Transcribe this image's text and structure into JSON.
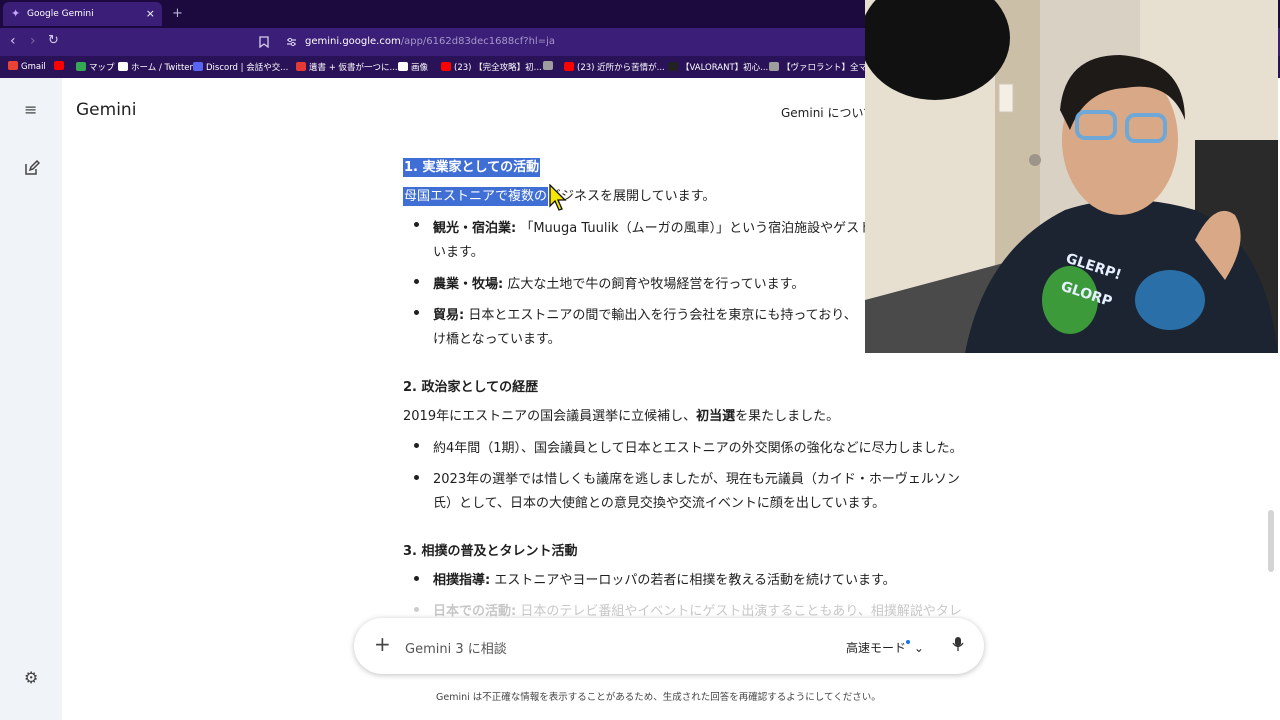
{
  "browser": {
    "tab_title": "Google Gemini",
    "tab_close": "×",
    "new_tab": "+",
    "url_host": "gemini.google.com",
    "url_path": "/app/6162d83dec1688cf?hl=ja",
    "bookmarks": [
      {
        "label": "Gmail",
        "color": "#ea4335"
      },
      {
        "label": "",
        "color": "#ff0000"
      },
      {
        "label": "マップ",
        "color": "#34a853"
      },
      {
        "label": "ホーム / Twitter",
        "color": "#ffffff"
      },
      {
        "label": "Discord | 会話や交...",
        "color": "#5865f2"
      },
      {
        "label": "遺書 + 仮書が一つに...",
        "color": "#e53935"
      },
      {
        "label": "画像",
        "color": "#ffffff"
      },
      {
        "label": "(23) 【完全攻略】初...",
        "color": "#ff0000"
      },
      {
        "label": "",
        "color": "#9e9e9e"
      },
      {
        "label": "(23) 近所から苦情が...",
        "color": "#ff0000"
      },
      {
        "label": "【VALORANT】初心...",
        "color": "#222222"
      },
      {
        "label": "【ヴァロラント】全マップ...",
        "color": "#9e9e9e"
      }
    ]
  },
  "app": {
    "brand": "Gemini",
    "about": "Gemini について"
  },
  "response": {
    "s1_heading": "1. 実業家としての活動",
    "s1_intro_sel": "母国エストニアで複数の",
    "s1_intro_rest": "ビジネスを展開しています。",
    "s1_b1_bold": "観光・宿泊業:",
    "s1_b1_text": " 「Muuga Tuulik（ムーガの風車）」という宿泊施設やゲスト",
    "s1_b1_line2": "います。",
    "s1_b2_bold": "農業・牧場:",
    "s1_b2_text": " 広大な土地で牛の飼育や牧場経営を行っています。",
    "s1_b3_bold": "貿易:",
    "s1_b3_text": " 日本とエストニアの間で輸出入を行う会社を東京にも持っており、",
    "s1_b3_line2": "け橋となっています。",
    "s2_heading": "2. 政治家としての経歴",
    "s2_intro_a": "2019年にエストニアの国会議員選挙に立候補し、",
    "s2_intro_bold": "初当選",
    "s2_intro_b": "を果たしました。",
    "s2_b1": "約4年間（1期）、国会議員として日本とエストニアの外交関係の強化などに尽力しました。",
    "s2_b2": "2023年の選挙では惜しくも議席を逃しましたが、現在も元議員（カイド・ホーヴェルソン",
    "s2_b2_line2": "氏）として、日本の大使館との意見交換や交流イベントに顔を出しています。",
    "s3_heading": "3. 相撲の普及とタレント活動",
    "s3_b1_bold": "相撲指導:",
    "s3_b1_text": " エストニアやヨーロッパの若者に相撲を教える活動を続けています。",
    "s3_b2_bold": "日本での活動:",
    "s3_b2_text": " 日本のテレビ番組やイベントにゲスト出演することもあり、相撲解説やタレ"
  },
  "input": {
    "placeholder": "Gemini 3 に相談",
    "mode": "高速モード"
  },
  "disclaimer": "Gemini は不正確な情報を表示することがあるため、生成された回答を再確認するようにしてください。",
  "webcam": {
    "shirt_text_1": "GLERP!",
    "shirt_text_2": "GLORP"
  },
  "colors": {
    "selection": "#3f6ed4",
    "chrome_dark": "#1c0a3f",
    "chrome": "#3b1e78"
  }
}
